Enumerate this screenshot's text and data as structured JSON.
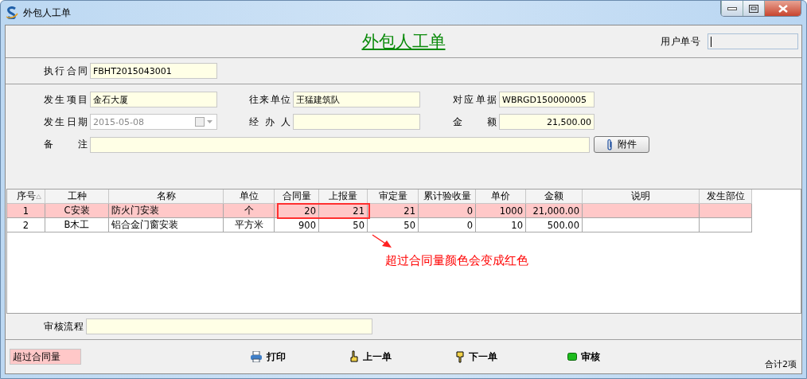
{
  "window": {
    "title": "外包人工单"
  },
  "header": {
    "title": "外包人工单",
    "user_no": {
      "label": "用户单号"
    }
  },
  "contract": {
    "label": "执行合同",
    "value": "FBHT2015043001"
  },
  "fields": [
    {
      "label": "发生项目",
      "value": "金石大厦",
      "disabled": false,
      "kind": "text"
    },
    {
      "label": "往来单位",
      "value": "王猛建筑队",
      "disabled": false,
      "kind": "text"
    },
    {
      "label": "对应单据",
      "value": "WBRGD150000005",
      "disabled": false,
      "kind": "text"
    },
    {
      "label": "发生日期",
      "value": "2015-05-08",
      "disabled": true,
      "kind": "date"
    },
    {
      "label": "经办人",
      "disabled": false,
      "kind": "text"
    },
    {
      "label": "金额",
      "value": "21,500.00",
      "disabled": false,
      "kind": "amount"
    }
  ],
  "remark": {
    "label": "备注",
    "attach_button": "附件"
  },
  "table": {
    "columns": [
      {
        "label": "序号",
        "sorted": true
      },
      {
        "label": "工种"
      },
      {
        "label": "名称"
      },
      {
        "label": "单位"
      },
      {
        "label": "合同量"
      },
      {
        "label": "上报量"
      },
      {
        "label": "审定量"
      },
      {
        "label": "累计验收量"
      },
      {
        "label": "单价"
      },
      {
        "label": "金额"
      },
      {
        "label": "说明"
      },
      {
        "label": "发生部位"
      }
    ],
    "rows": [
      {
        "over_contract": true,
        "cells": [
          "1",
          "C安装",
          "防火门安装",
          "个",
          "20",
          "21",
          "21",
          "0",
          "1000",
          "21,000.00",
          "",
          ""
        ]
      },
      {
        "over_contract": false,
        "cells": [
          "2",
          "B木工",
          "铝合金门窗安装",
          "平方米",
          "900",
          "50",
          "50",
          "0",
          "10",
          "500.00",
          "",
          ""
        ]
      }
    ],
    "annotation": "超过合同量颜色会变成红色"
  },
  "review": {
    "label": "审核流程"
  },
  "footer": {
    "legend": "超过合同量",
    "buttons": [
      {
        "kind": "print",
        "label": "打印"
      },
      {
        "kind": "prev",
        "label": "上一单"
      },
      {
        "kind": "next",
        "label": "下一单"
      },
      {
        "kind": "approve",
        "label": "审核"
      }
    ],
    "total": "合计2项"
  }
}
